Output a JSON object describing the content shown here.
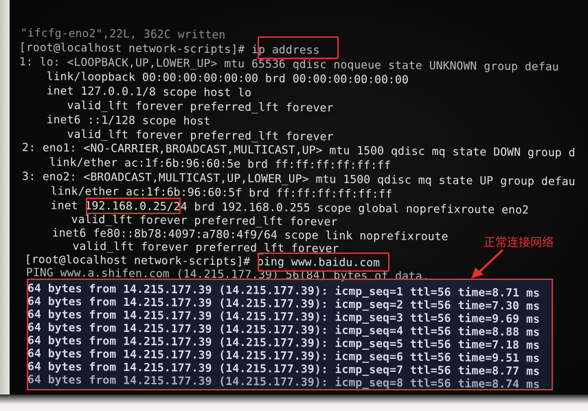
{
  "terminal": {
    "lines": [
      "\"ifcfg-eno2\",22L, 362C written",
      "[root@localhost network-scripts]# ip address",
      "1: lo: <LOOPBACK,UP,LOWER_UP> mtu 65536 qdisc noqueue state UNKNOWN group defau",
      "    link/loopback 00:00:00:00:00:00 brd 00:00:00:00:00:00",
      "    inet 127.0.0.1/8 scope host lo",
      "       valid_lft forever preferred_lft forever",
      "    inet6 ::1/128 scope host",
      "       valid_lft forever preferred_lft forever",
      "2: eno1: <NO-CARRIER,BROADCAST,MULTICAST,UP> mtu 1500 qdisc mq state DOWN group d",
      "    link/ether ac:1f:6b:96:60:5e brd ff:ff:ff:ff:ff:ff",
      "3: eno2: <BROADCAST,MULTICAST,UP,LOWER_UP> mtu 1500 qdisc mq state UP group defau",
      "    link/ether ac:1f:6b:96:60:5f brd ff:ff:ff:ff:ff:ff",
      "    inet 192.168.0.25/24 brd 192.168.0.255 scope global noprefixroute eno2",
      "       valid_lft forever preferred_lft forever",
      "    inet6 fe80::8b78:4097:a780:4f9/64 scope link noprefixroute",
      "       valid_lft forever preferred_lft forever",
      "[root@localhost network-scripts]# ping www.baidu.com",
      "PING www.a.shifen.com (14.215.177.39) 56(84) bytes of data."
    ],
    "ping_replies": [
      "64 bytes from 14.215.177.39 (14.215.177.39): icmp_seq=1 ttl=56 time=8.71 ms",
      "64 bytes from 14.215.177.39 (14.215.177.39): icmp_seq=2 ttl=56 time=7.30 ms",
      "64 bytes from 14.215.177.39 (14.215.177.39): icmp_seq=3 ttl=56 time=9.69 ms",
      "64 bytes from 14.215.177.39 (14.215.177.39): icmp_seq=4 ttl=56 time=8.88 ms",
      "64 bytes from 14.215.177.39 (14.215.177.39): icmp_seq=5 ttl=56 time=7.18 ms",
      "64 bytes from 14.215.177.39 (14.215.177.39): icmp_seq=6 ttl=56 time=9.51 ms",
      "64 bytes from 14.215.177.39 (14.215.177.39): icmp_seq=7 ttl=56 time=8.77 ms",
      "64 bytes from 14.215.177.39 (14.215.177.39): icmp_seq=8 ttl=56 time=8.74 ms"
    ]
  },
  "annotation": {
    "label": "正常连接网络",
    "color": "#e53030"
  },
  "colors": {
    "screen_bg": "#0b0b0b",
    "text": "#e4e4e4",
    "highlight": "#e53030"
  }
}
